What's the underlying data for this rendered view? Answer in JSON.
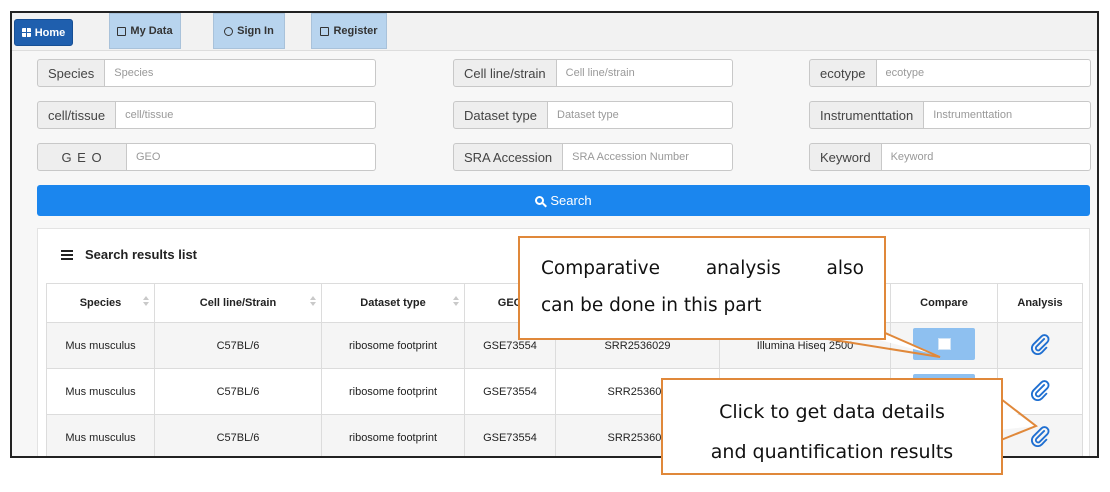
{
  "nav": {
    "home": "Home",
    "my_data": "My Data",
    "sign_in": "Sign In",
    "register": "Register"
  },
  "form": {
    "species_label": "Species",
    "species_placeholder": "Species",
    "cell_line_label": "Cell line/strain",
    "cell_line_placeholder": "Cell line/strain",
    "ecotype_label": "ecotype",
    "ecotype_placeholder": "ecotype",
    "tissue_label": "cell/tissue",
    "tissue_placeholder": "cell/tissue",
    "dataset_label": "Dataset type",
    "dataset_placeholder": "Dataset type",
    "instrument_label": "Instrumenttation",
    "instrument_placeholder": "Instrumenttation",
    "geo_label": "G E O",
    "geo_placeholder": "GEO",
    "sra_label": "SRA Accession",
    "sra_placeholder": "SRA Accession Number",
    "keyword_label": "Keyword",
    "keyword_placeholder": "Keyword",
    "search_button": "Search"
  },
  "results": {
    "title": "Search results list",
    "columns": [
      "Species",
      "Cell line/Strain",
      "Dataset type",
      "GEO",
      "",
      "",
      "Compare",
      "Analysis"
    ],
    "rows": [
      [
        "Mus musculus",
        "C57BL/6",
        "ribosome footprint",
        "GSE73554",
        "SRR2536029",
        "Illumina Hiseq 2500"
      ],
      [
        "Mus musculus",
        "C57BL/6",
        "ribosome footprint",
        "GSE73554",
        "SRR253603",
        ""
      ],
      [
        "Mus musculus",
        "C57BL/6",
        "ribosome footprint",
        "GSE73554",
        "SRR253603",
        ""
      ]
    ]
  },
  "callouts": {
    "compare_line1_words": [
      "Comparative",
      "analysis",
      "also"
    ],
    "compare_line2": "can be done in this part",
    "analysis_line1": "Click to get data details",
    "analysis_line2": "and quantification results"
  },
  "colors": {
    "nav_active": "#1f5fae",
    "nav_tab": "#b8d4ee",
    "search_button": "#1b86ee",
    "compare_button": "#8ec0f0",
    "callout_border": "#e0883a",
    "clip_icon": "#1f6fd1"
  },
  "icons": {
    "home": "grid-icon",
    "my_data": "list-box-icon",
    "sign_in": "circle-arrow-icon",
    "register": "edit-icon",
    "search": "search-icon",
    "results": "list-icon",
    "analysis": "paperclip-icon"
  }
}
